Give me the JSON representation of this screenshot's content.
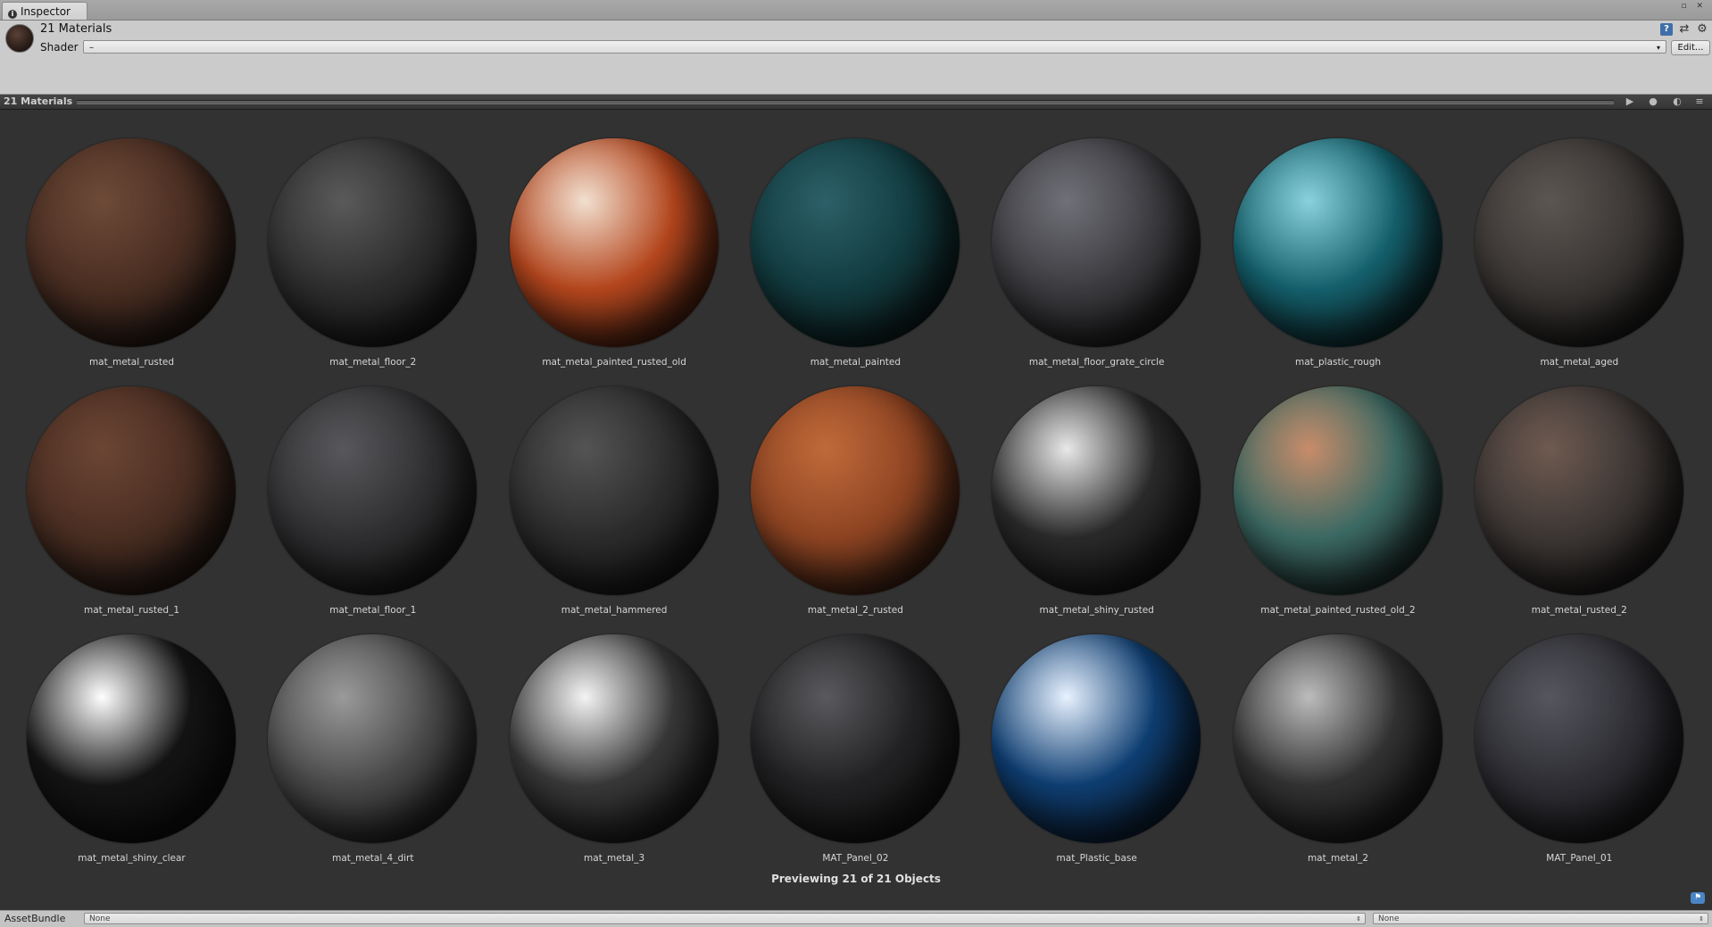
{
  "window": {
    "tab_label": "Inspector"
  },
  "header": {
    "title": "21 Materials",
    "shader_label": "Shader",
    "shader_value": "–",
    "edit_label": "Edit..."
  },
  "preview": {
    "title": "21 Materials",
    "count_text": "Previewing 21 of 21 Objects"
  },
  "materials": [
    {
      "name": "mat_metal_rusted",
      "base": "#4a2e22",
      "highlight": "#6e4a38"
    },
    {
      "name": "mat_metal_floor_2",
      "base": "#2e2e2e",
      "highlight": "#5a5a5a"
    },
    {
      "name": "mat_metal_painted_rusted_old",
      "base": "#b4461d",
      "highlight": "#f2e0d0"
    },
    {
      "name": "mat_metal_painted",
      "base": "#123c40",
      "highlight": "#2c6068"
    },
    {
      "name": "mat_metal_floor_grate_circle",
      "base": "#3c3c40",
      "highlight": "#707078"
    },
    {
      "name": "mat_plastic_rough",
      "base": "#14606c",
      "highlight": "#8ad2dc"
    },
    {
      "name": "mat_metal_aged",
      "base": "#3a3634",
      "highlight": "#5c5652"
    },
    {
      "name": "mat_metal_rusted_1",
      "base": "#4a2e22",
      "highlight": "#6c4534"
    },
    {
      "name": "mat_metal_floor_1",
      "base": "#303032",
      "highlight": "#58585c"
    },
    {
      "name": "mat_metal_hammered",
      "base": "#2c2c2c",
      "highlight": "#545454"
    },
    {
      "name": "mat_metal_2_rusted",
      "base": "#8e4422",
      "highlight": "#c06a3a"
    },
    {
      "name": "mat_metal_shiny_rusted",
      "base": "#2a2a2a",
      "highlight": "#e8e8e8"
    },
    {
      "name": "mat_metal_painted_rusted_old_2",
      "base": "#3c6a64",
      "highlight": "#c88c6a"
    },
    {
      "name": "mat_metal_rusted_2",
      "base": "#3c3634",
      "highlight": "#6e5a50"
    },
    {
      "name": "mat_metal_shiny_clear",
      "base": "#141414",
      "highlight": "#ffffff"
    },
    {
      "name": "mat_metal_4_dirt",
      "base": "#4a4a4a",
      "highlight": "#9a9a9a"
    },
    {
      "name": "mat_metal_3",
      "base": "#383838",
      "highlight": "#f4f4f4"
    },
    {
      "name": "MAT_Panel_02",
      "base": "#222224",
      "highlight": "#5a5a5e"
    },
    {
      "name": "mat_Plastic_base",
      "base": "#0e3e72",
      "highlight": "#e8f2ff"
    },
    {
      "name": "mat_metal_2",
      "base": "#323232",
      "highlight": "#bcbcbc"
    },
    {
      "name": "MAT_Panel_01",
      "base": "#2e2e34",
      "highlight": "#56565e"
    }
  ],
  "footer": {
    "assetbundle_label": "AssetBundle",
    "bundle_value": "None",
    "variant_value": "None"
  }
}
